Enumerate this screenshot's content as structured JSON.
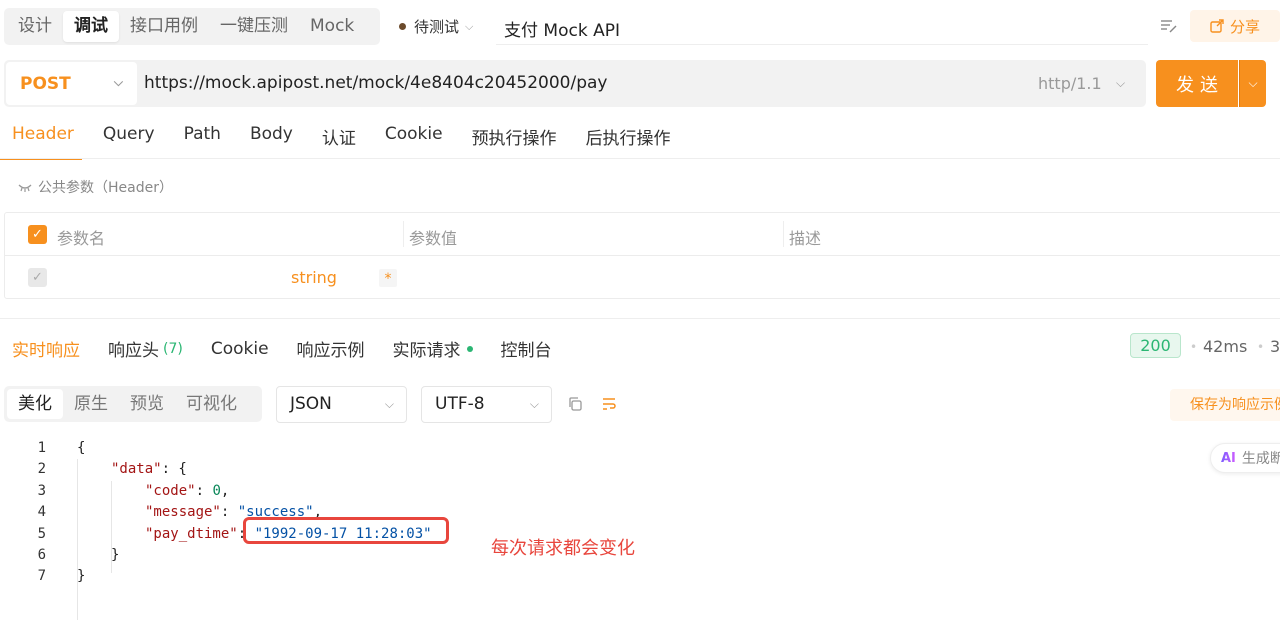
{
  "mode_tabs": [
    "设计",
    "调试",
    "接口用例",
    "一键压测",
    "Mock"
  ],
  "active_mode": "调试",
  "status": {
    "label": "待测试",
    "color": "#6b4a2b"
  },
  "api_title": "支付 Mock API",
  "share_label": "分享",
  "request": {
    "method": "POST",
    "url": "https://mock.apipost.net/mock/4e8404c20452000/pay",
    "protocol": "http/1.1",
    "send_label": "发送"
  },
  "request_tabs": [
    "Header",
    "Query",
    "Path",
    "Body",
    "认证",
    "Cookie",
    "预执行操作",
    "后执行操作"
  ],
  "common_header_label": "公共参数（Header）",
  "param_table": {
    "columns": [
      "参数名",
      "参数值",
      "描述"
    ],
    "row": {
      "type": "string",
      "required_mark": "*"
    }
  },
  "response_tabs": [
    {
      "label": "实时响应"
    },
    {
      "label": "响应头",
      "count": "(7)"
    },
    {
      "label": "Cookie"
    },
    {
      "label": "响应示例"
    },
    {
      "label": "实际请求"
    },
    {
      "label": "控制台"
    }
  ],
  "response_meta": {
    "status_code": "200",
    "time": "42ms",
    "size": "3"
  },
  "view_tabs": [
    "美化",
    "原生",
    "预览",
    "可视化"
  ],
  "format_select": "JSON",
  "encoding_select": "UTF-8",
  "save_example_label": "保存为响应示例",
  "ai_label": "生成断",
  "code": {
    "line_numbers": [
      "1",
      "2",
      "3",
      "4",
      "5",
      "6",
      "7"
    ],
    "l1": "{",
    "l2_key": "\"data\"",
    "l2_rest": ": {",
    "l3_key": "\"code\"",
    "l3_num": "0",
    "l4_key": "\"message\"",
    "l4_str": "\"success\"",
    "l5_key": "\"pay_dtime\"",
    "l5_str": "\"1992-09-17 11:28:03\"",
    "l6": "}",
    "l7": "}"
  },
  "annotation": "每次请求都会变化",
  "colors": {
    "accent": "#f7901e",
    "success": "#2bb673",
    "annotation": "#e8463d"
  }
}
